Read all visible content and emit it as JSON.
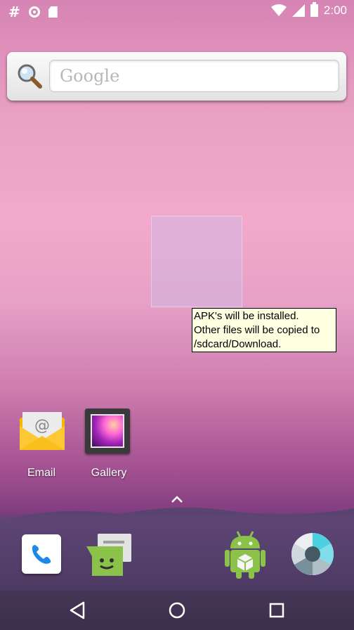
{
  "status_bar": {
    "time": "2:00",
    "left_icons": [
      "hash-icon",
      "sync-circle-icon",
      "sd-card-icon"
    ],
    "right_icons": [
      "wifi-icon",
      "signal-icon",
      "battery-icon"
    ]
  },
  "search_widget": {
    "placeholder": "Google",
    "icon": "magnifier-icon"
  },
  "drop_tooltip": {
    "lines": [
      "APK's will be installed.",
      "Other files will be copied to",
      "/sdcard/Download."
    ]
  },
  "home_apps": [
    {
      "label": "Email",
      "icon": "email-icon"
    },
    {
      "label": "Gallery",
      "icon": "gallery-icon"
    }
  ],
  "dock_icons": [
    "phone-icon",
    "messaging-icon",
    "store-icon",
    "camera-icon"
  ],
  "nav_icons": [
    "back-icon",
    "home-icon",
    "recents-icon"
  ],
  "colors": {
    "tooltip_bg": "#ffffe1",
    "phone_blue": "#1e88e5",
    "messaging_green": "#8bc34a",
    "android_green": "#8bc34a"
  }
}
